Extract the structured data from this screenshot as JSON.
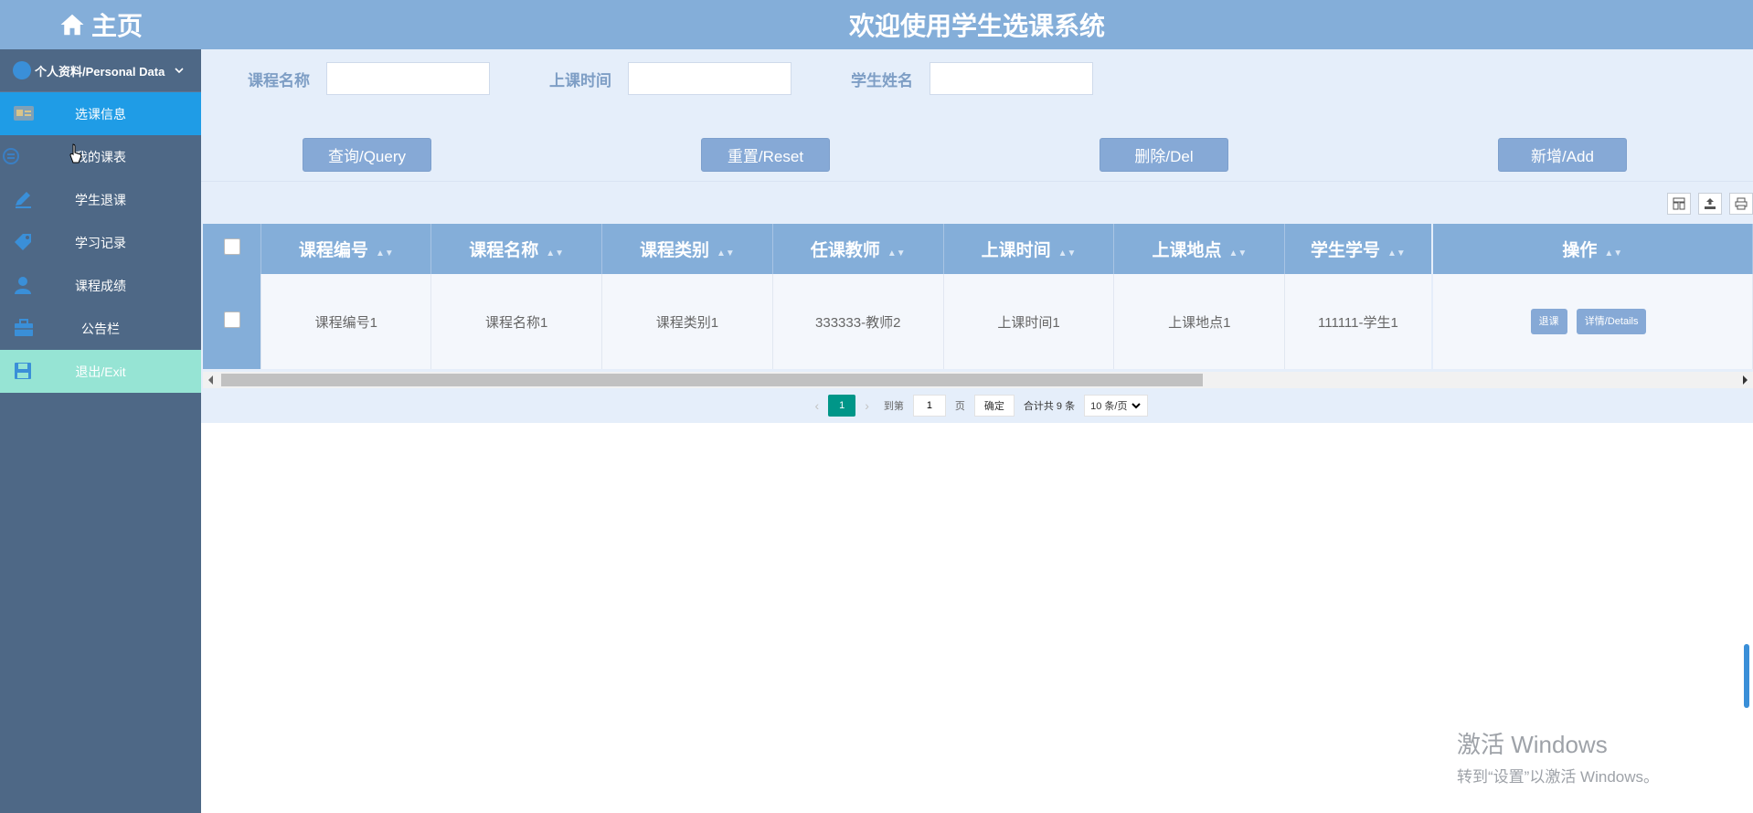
{
  "sidebar": {
    "home_label": "主页",
    "profile_label": "个人资料/Personal Data",
    "items": [
      {
        "label": "选课信息",
        "icon": "id-card-icon",
        "active": true
      },
      {
        "label": "我的课表",
        "icon": "list-icon"
      },
      {
        "label": "学生退课",
        "icon": "pencil-icon"
      },
      {
        "label": "学习记录",
        "icon": "tag-icon"
      },
      {
        "label": "课程成绩",
        "icon": "user-icon"
      },
      {
        "label": "公告栏",
        "icon": "briefcase-icon"
      },
      {
        "label": "退出/Exit",
        "icon": "save-icon"
      }
    ]
  },
  "header": {
    "title": "欢迎使用学生选课系统"
  },
  "search": {
    "fields": [
      {
        "label": "课程名称",
        "value": ""
      },
      {
        "label": "上课时间",
        "value": ""
      },
      {
        "label": "学生姓名",
        "value": ""
      }
    ],
    "buttons": {
      "query": "查询/Query",
      "reset": "重置/Reset",
      "del": "删除/Del",
      "add": "新增/Add"
    }
  },
  "table": {
    "columns": [
      "课程编号",
      "课程名称",
      "课程类别",
      "任课教师",
      "上课时间",
      "上课地点",
      "学生学号",
      "操作"
    ],
    "rows": [
      {
        "cells": [
          "课程编号1",
          "课程名称1",
          "课程类别1",
          "333333-教师2",
          "上课时间1",
          "上课地点1",
          "111111-学生1"
        ],
        "actions": [
          "退课",
          "详情/Details"
        ]
      }
    ]
  },
  "pager": {
    "current_page": "1",
    "goto_prefix": "到第",
    "goto_value": "1",
    "goto_suffix": "页",
    "confirm": "确定",
    "total": "合计共 9 条",
    "page_size": "10 条/页"
  },
  "watermark": {
    "line1": "激活 Windows",
    "line2": "转到“设置”以激活 Windows。"
  },
  "colors": {
    "header": "#84aed9",
    "sidebar": "#4e6886",
    "active_item": "#1f9ce6",
    "exit_item": "#96e4d4",
    "panel": "#e5eefa",
    "pager_current": "#009688"
  }
}
